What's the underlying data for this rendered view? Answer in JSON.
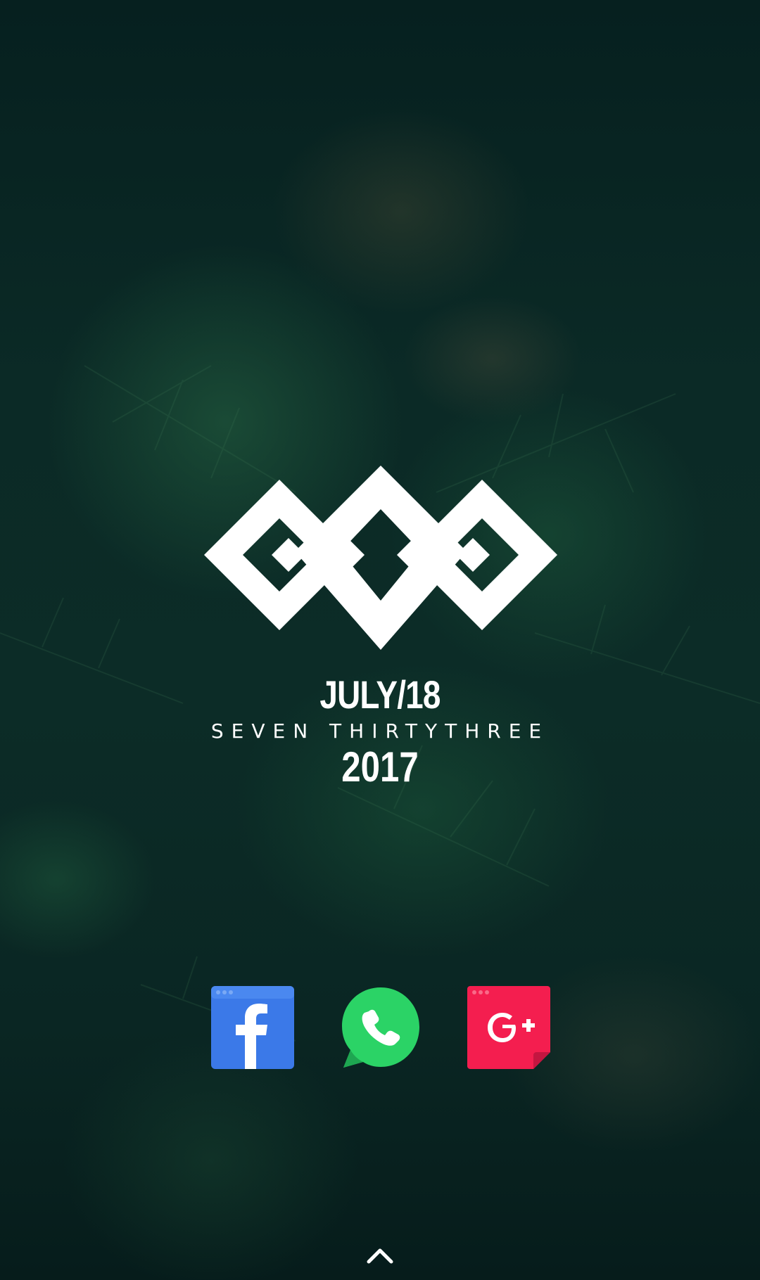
{
  "screen": {
    "type": "android-home-screen",
    "background": "forest-foliage-wallpaper"
  },
  "widget": {
    "logo_icon": "diamond-pattern-logo",
    "date_text": "JULY/18",
    "time_text": "SEVEN THIRTYTHREE",
    "year_text": "2017"
  },
  "dock": {
    "apps": [
      {
        "name": "Facebook",
        "icon": "facebook-icon",
        "color": "#3b79e8"
      },
      {
        "name": "WhatsApp",
        "icon": "whatsapp-icon",
        "color": "#2bd366"
      },
      {
        "name": "Google+",
        "icon": "google-plus-icon",
        "color": "#f41e4f"
      }
    ]
  },
  "app_drawer": {
    "icon": "chevron-up-icon"
  }
}
